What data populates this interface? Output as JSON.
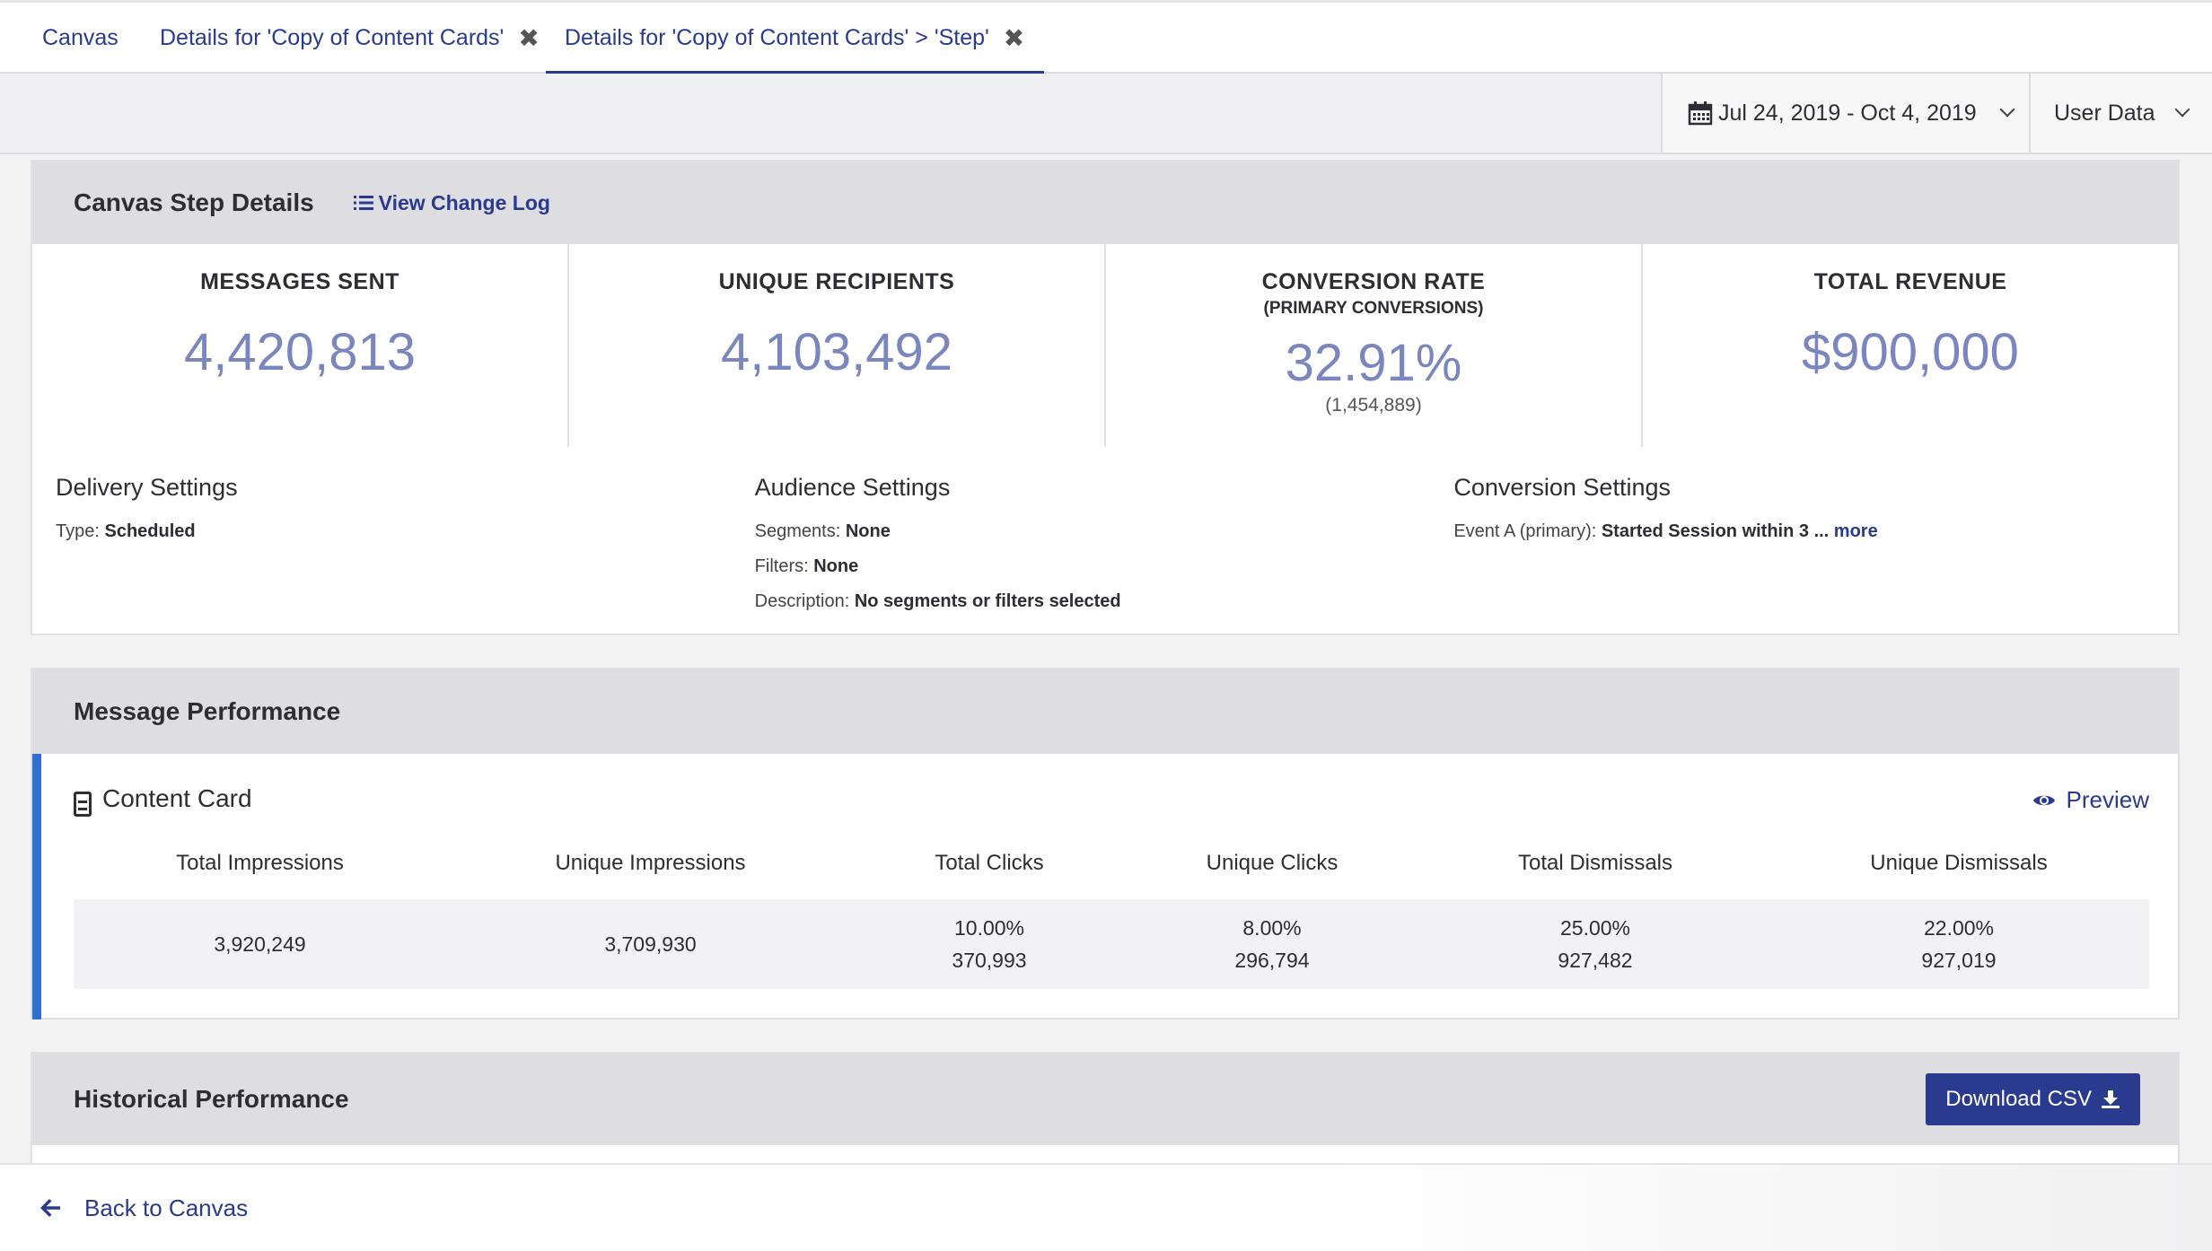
{
  "tabs": [
    {
      "label": "Canvas",
      "closable": false,
      "active": false
    },
    {
      "label": "Details for 'Copy of Content Cards'",
      "closable": true,
      "active": false
    },
    {
      "label": "Details for 'Copy of Content Cards' > 'Step'",
      "closable": true,
      "active": true
    }
  ],
  "filters": {
    "date_range": "Jul 24, 2019 - Oct 4, 2019",
    "data_type": "User Data"
  },
  "step_details": {
    "title": "Canvas Step Details",
    "change_log_label": "View Change Log",
    "kpis": [
      {
        "label": "MESSAGES SENT",
        "value": "4,420,813"
      },
      {
        "label": "UNIQUE RECIPIENTS",
        "value": "4,103,492"
      },
      {
        "label": "CONVERSION RATE",
        "sublabel": "(PRIMARY CONVERSIONS)",
        "value": "32.91%",
        "count": "(1,454,889)"
      },
      {
        "label": "TOTAL REVENUE",
        "value": "$900,000"
      }
    ],
    "delivery": {
      "title": "Delivery Settings",
      "type_label": "Type:",
      "type_value": "Scheduled"
    },
    "audience": {
      "title": "Audience Settings",
      "segments_label": "Segments:",
      "segments_value": "None",
      "filters_label": "Filters:",
      "filters_value": "None",
      "description_label": "Description:",
      "description_value": "No segments or filters selected"
    },
    "conversion": {
      "title": "Conversion Settings",
      "event_label": "Event A (primary):",
      "event_value": "Started Session within 3 ...",
      "more_label": "more"
    }
  },
  "message_performance": {
    "title": "Message Performance",
    "channel": "Content Card",
    "preview_label": "Preview",
    "columns": [
      "Total Impressions",
      "Unique Impressions",
      "Total Clicks",
      "Unique Clicks",
      "Total Dismissals",
      "Unique Dismissals"
    ],
    "row": [
      {
        "pct": "",
        "value": "3,920,249"
      },
      {
        "pct": "",
        "value": "3,709,930"
      },
      {
        "pct": "10.00%",
        "value": "370,993"
      },
      {
        "pct": "8.00%",
        "value": "296,794"
      },
      {
        "pct": "25.00%",
        "value": "927,482"
      },
      {
        "pct": "22.00%",
        "value": "927,019"
      }
    ]
  },
  "historical": {
    "title": "Historical Performance",
    "download_label": "Download CSV"
  },
  "footer": {
    "back_label": "Back to Canvas"
  },
  "colors": {
    "accent": "#2a3a8f",
    "kpi_value": "#7a86bd",
    "channel_bar": "#2f6fd0"
  }
}
